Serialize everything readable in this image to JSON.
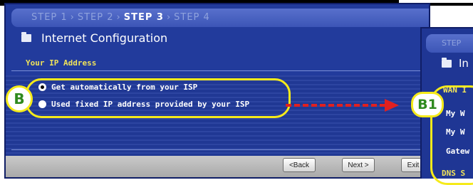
{
  "wizard": {
    "steps": [
      "STEP 1",
      "STEP 2",
      "STEP 3",
      "STEP 4"
    ],
    "current_step": "STEP 3",
    "title": "Internet Configuration",
    "section": "Your IP Address",
    "options": [
      {
        "label": "Get automatically from your ISP",
        "selected": true
      },
      {
        "label": "Used fixed IP address provided by your ISP",
        "selected": false
      }
    ],
    "buttons": {
      "back": "<Back",
      "next": "Next >",
      "exit": "Exit"
    }
  },
  "callouts": {
    "b": "B",
    "b1": "B1"
  },
  "next_panel": {
    "step": "STEP",
    "title": "In",
    "wan": "WAN I",
    "my_wan_1": "My W",
    "my_wan_2": "My W",
    "gateway": "Gatew",
    "dns": "DNS S"
  },
  "colors": {
    "panel": "#223b9c",
    "highlight": "#f5ea1a",
    "callout_text": "#2f8a1e",
    "arrow": "#e02020"
  }
}
